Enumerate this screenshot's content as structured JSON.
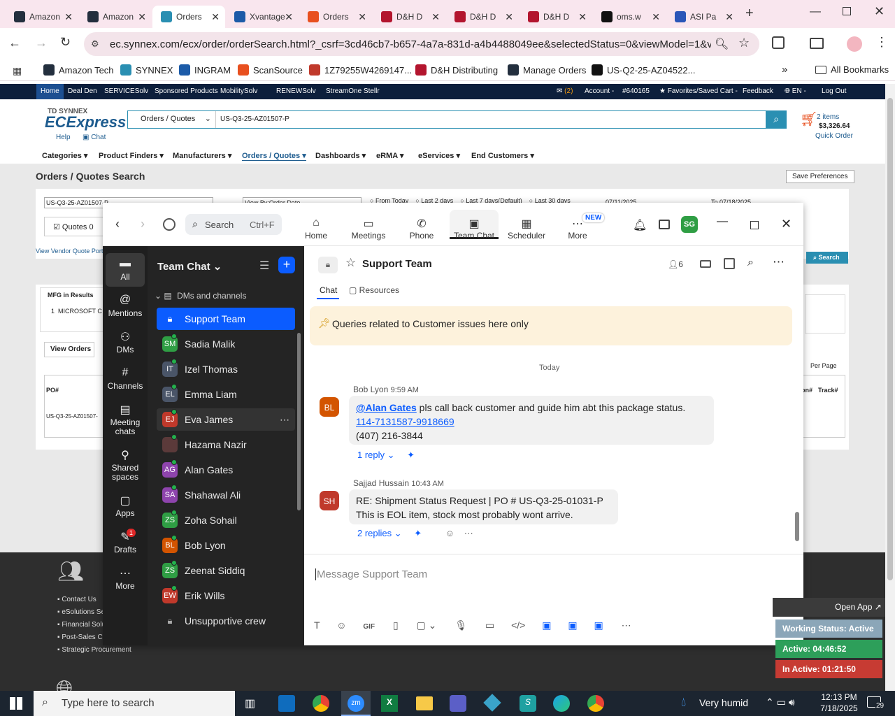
{
  "browser": {
    "tabs": [
      {
        "label": "Amazon",
        "color": "#232f3e",
        "active": false
      },
      {
        "label": "Amazon",
        "color": "#232f3e",
        "active": false
      },
      {
        "label": "Orders",
        "color": "#2a8fb2",
        "active": true
      },
      {
        "label": "Xvantage",
        "color": "#1c5ba8",
        "active": false
      },
      {
        "label": "Orders",
        "color": "#e8501f",
        "active": false
      },
      {
        "label": "D&H D",
        "color": "#b3152e",
        "active": false
      },
      {
        "label": "D&H D",
        "color": "#b3152e",
        "active": false
      },
      {
        "label": "D&H D",
        "color": "#b3152e",
        "active": false
      },
      {
        "label": "oms.w",
        "color": "#111",
        "active": false
      },
      {
        "label": "ASI Pa",
        "color": "#2a56b8",
        "active": false
      }
    ],
    "url": "ec.synnex.com/ecx/order/orderSearch.html?_csrf=3cd46cb7-b657-4a7a-831d-a4b4488049ee&selectedStatus=0&viewModel=1&viewBy...",
    "bookmarks": [
      "Amazon Tech",
      "SYNNEX",
      "INGRAM",
      "ScanSource",
      "1Z79255W4269147...",
      "D&H Distributing",
      "Manage Orders",
      "US-Q2-25-AZ04522..."
    ],
    "all_bookmarks": "All Bookmarks"
  },
  "site": {
    "topnav": [
      "Home",
      "Deal Den",
      "SERVICESolv",
      "Sponsored Products",
      "MobilitySolv",
      "RENEWSolv",
      "StreamOne Stellr"
    ],
    "topnav_right": {
      "mail_count": "(2)",
      "account": "Account -",
      "account_no": "#640165",
      "favorites": "Favorites/Saved Cart -",
      "feedback": "Feedback",
      "lang": "EN -",
      "logout": "Log Out"
    },
    "logo_top": "TD SYNNEX",
    "logo_main": "ECExpress",
    "help": "Help",
    "chat": "Chat",
    "search_type": "Orders / Quotes",
    "search_value": "US-Q3-25-AZ01507-P",
    "cart_items": "2 items",
    "cart_total": "$3,326.64",
    "quick_order": "Quick Order",
    "catnav": [
      "Categories",
      "Product Finders",
      "Manufacturers",
      "Orders / Quotes",
      "Dashboards",
      "eRMA",
      "eServices",
      "End Customers"
    ],
    "page_title": "Orders / Quotes Search",
    "save_prefs": "Save Preferences",
    "filter_po": "US-Q3-25-AZ01507-P",
    "view_by": "View By:Order Date",
    "date_opts": [
      "From Today",
      "Last 2 days",
      "Last 7 days(Default)",
      "Last 30 days"
    ],
    "date_from": "07/11/2025",
    "date_to": "To 07/18/2025",
    "quotes_label": "Quotes 0",
    "vendor_link": "View Vendor Quote Port",
    "mfg_title": "MFG in Results",
    "mfg_item": "1  MICROSOFT C",
    "view_orders": "View Orders",
    "per_page": "Per Page",
    "col_po": "PO#",
    "col_on": "on#",
    "col_track": "Track#",
    "row_po": "US-Q3-25-AZ01507-",
    "search_btn": "Search",
    "footer_links": [
      "Contact Us",
      "eSolutions Se",
      "Financial Solu",
      "Post-Sales C",
      "Strategic Procurement"
    ]
  },
  "zoom": {
    "search_label": "Search",
    "search_shortcut": "Ctrl+F",
    "nav": [
      {
        "label": "Home",
        "active": false
      },
      {
        "label": "Meetings",
        "active": false
      },
      {
        "label": "Phone",
        "active": false
      },
      {
        "label": "Team Chat",
        "active": true
      },
      {
        "label": "Scheduler",
        "active": false
      },
      {
        "label": "More",
        "active": false
      }
    ],
    "new_badge": "NEW",
    "user_initials": "SG",
    "side": [
      {
        "label": "All",
        "icon": "chat-icon"
      },
      {
        "label": "Mentions",
        "icon": "at-icon"
      },
      {
        "label": "DMs",
        "icon": "people-icon"
      },
      {
        "label": "Channels",
        "icon": "hash-icon"
      },
      {
        "label": "Meeting chats",
        "icon": "calendar-icon"
      },
      {
        "label": "Shared spaces",
        "icon": "share-icon"
      },
      {
        "label": "Apps",
        "icon": "apps-icon"
      },
      {
        "label": "Drafts",
        "icon": "draft-icon",
        "badge": "1"
      },
      {
        "label": "More",
        "icon": "more-icon"
      }
    ],
    "list_title": "Team Chat",
    "section": "DMs and channels",
    "contacts": [
      {
        "name": "Support Team",
        "initials": "",
        "color": "#0b5cff",
        "selected": true
      },
      {
        "name": "Sadia Malik",
        "initials": "SM",
        "color": "#2f9e44"
      },
      {
        "name": "Izel Thomas",
        "initials": "IT",
        "color": "#4a5568"
      },
      {
        "name": "Emma Liam",
        "initials": "EL",
        "color": "#4a5568"
      },
      {
        "name": "Eva James",
        "initials": "EJ",
        "color": "#c0392b",
        "hover": true
      },
      {
        "name": "Hazama Nazir",
        "initials": "",
        "color": "#5b3a3a"
      },
      {
        "name": "Alan Gates",
        "initials": "AG",
        "color": "#8e44ad"
      },
      {
        "name": "Shahawal Ali",
        "initials": "SA",
        "color": "#8e44ad"
      },
      {
        "name": "Zoha Sohail",
        "initials": "ZS",
        "color": "#2f9e44"
      },
      {
        "name": "Bob Lyon",
        "initials": "BL",
        "color": "#d35400"
      },
      {
        "name": "Zeenat Siddiq",
        "initials": "ZS",
        "color": "#2f9e44"
      },
      {
        "name": "Erik Wills",
        "initials": "EW",
        "color": "#c0392b"
      },
      {
        "name": "Unsupportive crew",
        "initials": "",
        "color": "#3a3a3a"
      }
    ],
    "channel": "Support Team",
    "members": "6",
    "tabs": [
      "Chat",
      "Resources"
    ],
    "pinned": "Queries related to Customer issues here only",
    "day": "Today",
    "messages": [
      {
        "sender": "Bob Lyon",
        "time": "9:59 AM",
        "initials": "BL",
        "color": "#d35400",
        "mention": "@Alan Gates",
        "text": " pls call back customer and guide him abt this package status.",
        "link": "114-7131587-9918669",
        "line3": "(407) 216-3844",
        "replies": "1 reply"
      },
      {
        "sender": "Sajjad Hussain",
        "time": "10:43 AM",
        "initials": "SH",
        "color": "#c0392b",
        "text": "RE: Shipment Status Request | PO # US-Q3-25-01031-P",
        "line2": "This is EOL item, stock most probably wont arrive.",
        "replies": "2 replies"
      }
    ],
    "compose_placeholder": "Message Support Team"
  },
  "open_app": "Open App",
  "work_status": {
    "title": "Working Status: Active",
    "active": "Active: 04:46:52",
    "inactive": "In Active: 01:21:50"
  },
  "taskbar": {
    "search_placeholder": "Type here to search",
    "weather": "Very humid",
    "time": "12:13 PM",
    "date": "7/18/2025",
    "notif": "29"
  }
}
